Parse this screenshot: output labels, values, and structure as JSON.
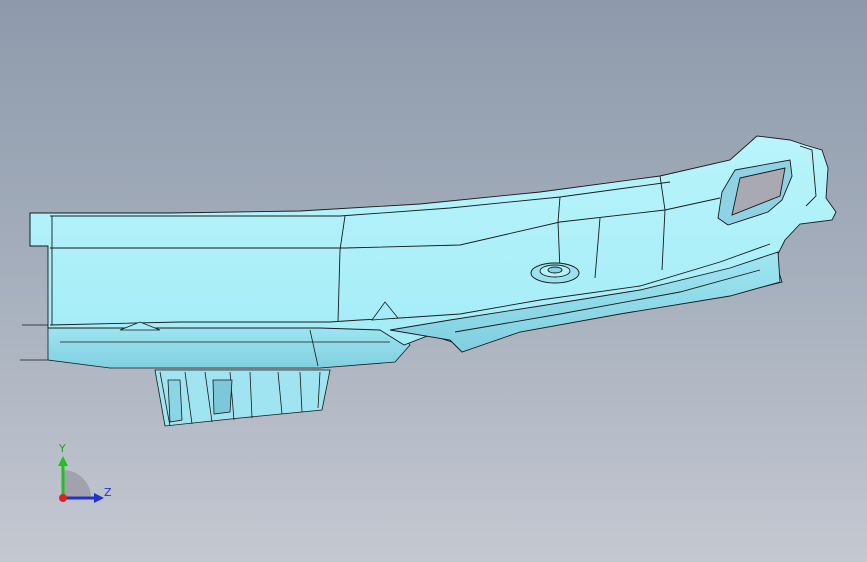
{
  "viewport": {
    "background_top": "#8e9aab",
    "background_bottom": "#c4c8d1",
    "model_fill": "#a8f0fa",
    "model_shade": "#8fdcea",
    "edge_color": "#1a1a1a"
  },
  "triad": {
    "y_label": "Y",
    "z_label": "Z",
    "y_color": "#22c022",
    "z_color": "#2233cc",
    "x_color": "#dd2222"
  }
}
